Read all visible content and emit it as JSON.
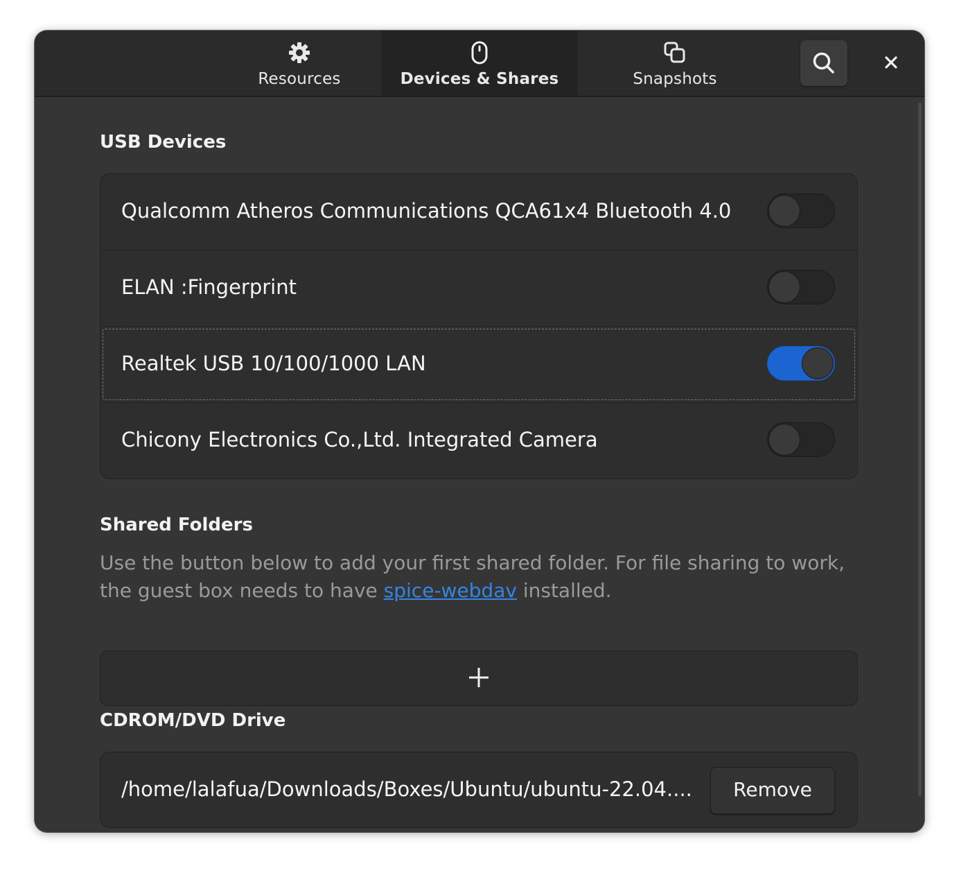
{
  "header": {
    "tabs": [
      {
        "label": "Resources",
        "icon": "gear-icon",
        "active": false
      },
      {
        "label": "Devices & Shares",
        "icon": "mouse-icon",
        "active": true
      },
      {
        "label": "Snapshots",
        "icon": "snapshots-icon",
        "active": false
      }
    ],
    "search_icon": "search-icon",
    "close_icon": "close-icon"
  },
  "usb": {
    "title": "USB Devices",
    "devices": [
      {
        "label": "Qualcomm Atheros Communications QCA61x4 Bluetooth 4.0",
        "enabled": false
      },
      {
        "label": "ELAN :Fingerprint",
        "enabled": false
      },
      {
        "label": "Realtek USB 10/100/1000 LAN",
        "enabled": true
      },
      {
        "label": "Chicony Electronics Co.,Ltd. Integrated Camera",
        "enabled": false
      }
    ]
  },
  "shared": {
    "title": "Shared Folders",
    "desc_before": "Use the button below to add your first shared folder. For file sharing to work, the guest box needs to have ",
    "link": "spice-webdav",
    "desc_after": " installed.",
    "add_icon": "plus-icon"
  },
  "cdrom": {
    "title": "CDROM/DVD Drive",
    "path": "/home/lalafua/Downloads/Boxes/Ubuntu/ubuntu-22.04....",
    "remove_label": "Remove"
  },
  "colors": {
    "accent": "#1c64d2",
    "link": "#3584e4",
    "window_bg": "#353535",
    "header_bg": "#2b2b2b"
  }
}
